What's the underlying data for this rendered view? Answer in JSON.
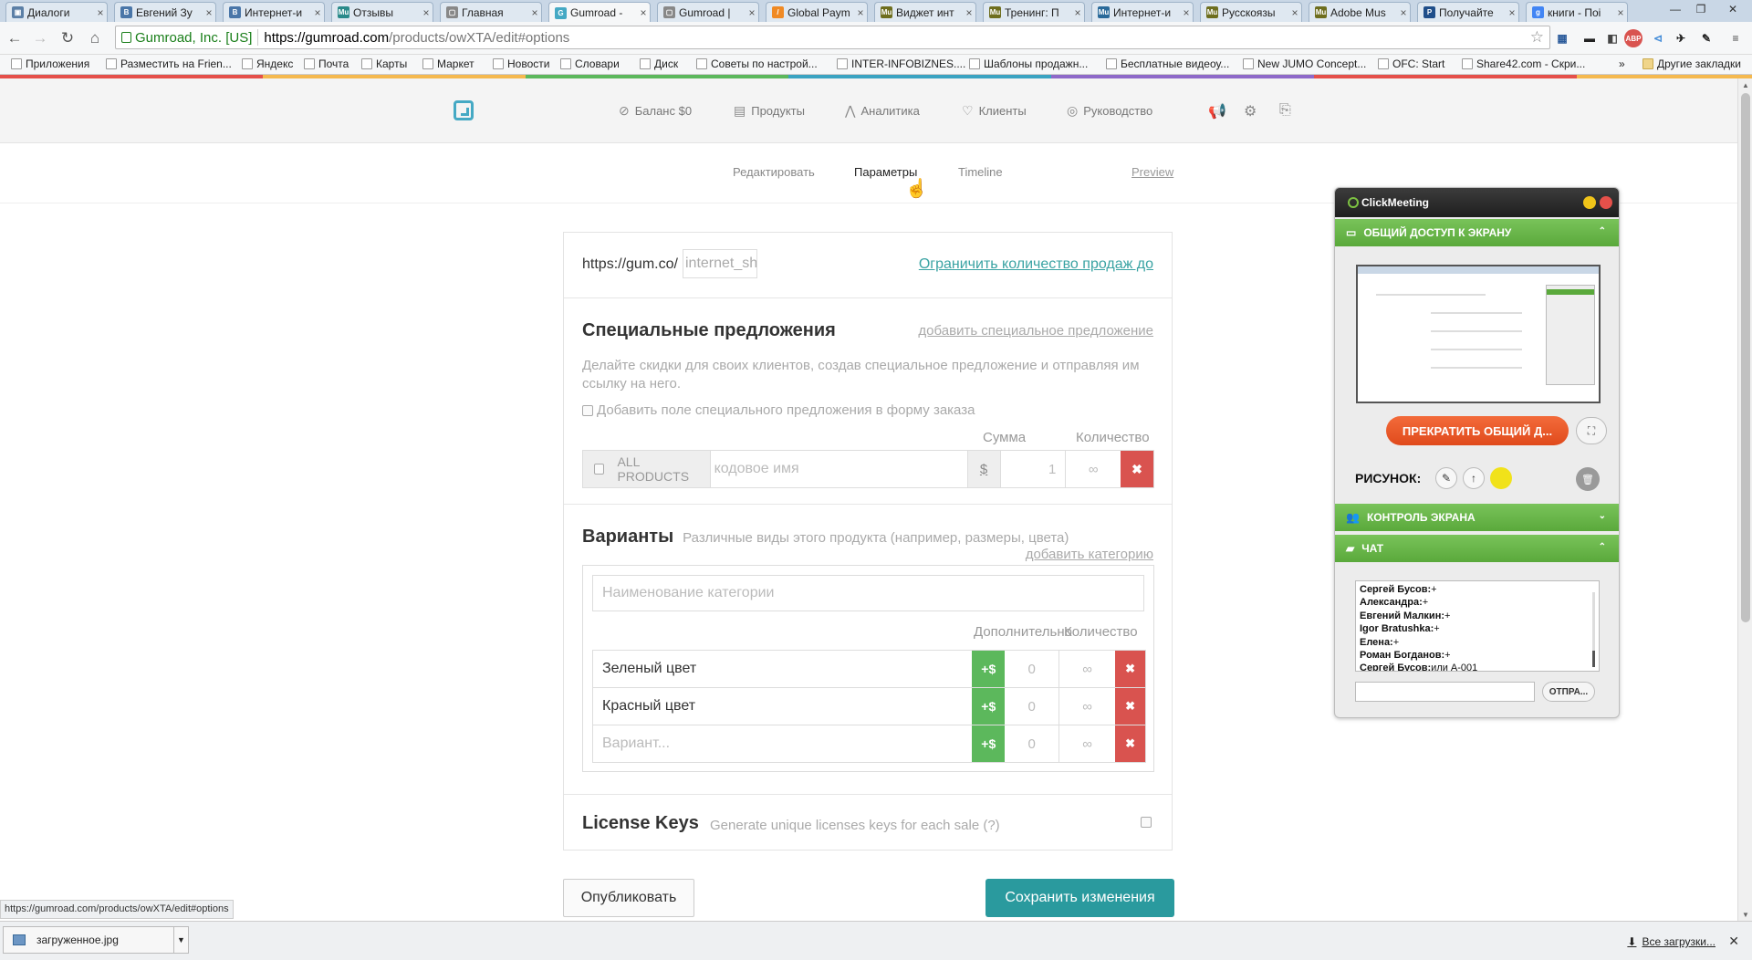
{
  "browser": {
    "tabs": [
      {
        "label": "Диалоги",
        "color": "#5b7fa6",
        "glyph": "▣"
      },
      {
        "label": "Евгений Зу",
        "color": "#4a76a8",
        "glyph": "B"
      },
      {
        "label": "Интернет-и",
        "color": "#4a76a8",
        "glyph": "B"
      },
      {
        "label": "Отзывы",
        "color": "#2a8a8a",
        "glyph": "Mu"
      },
      {
        "label": "Главная",
        "color": "#888888",
        "glyph": "▢"
      },
      {
        "label": "Gumroad -",
        "color": "#45a9c4",
        "glyph": "G"
      },
      {
        "label": "Gumroad |",
        "color": "#888888",
        "glyph": "▢"
      },
      {
        "label": "Global Paym",
        "color": "#f08a24",
        "glyph": "/"
      },
      {
        "label": "Виджет инт",
        "color": "#6e6e1e",
        "glyph": "Mu"
      },
      {
        "label": "Тренинг: П",
        "color": "#6e6e1e",
        "glyph": "Mu"
      },
      {
        "label": "Интернет-и",
        "color": "#2a6a9a",
        "glyph": "Mu"
      },
      {
        "label": "Русскоязы",
        "color": "#6e6e1e",
        "glyph": "Mu"
      },
      {
        "label": "Adobe Mus",
        "color": "#6e6e1e",
        "glyph": "Mu"
      },
      {
        "label": "Получайте",
        "color": "#1f4e8a",
        "glyph": "P"
      },
      {
        "label": "книги - Поі",
        "color": "#4285f4",
        "glyph": "g"
      }
    ],
    "secure_label": "Gumroad, Inc. [US]",
    "url_host": "https://gumroad.com",
    "url_path": "/products/owXTA/edit#options",
    "bookmarks": [
      "Приложения",
      "Разместить на Frien...",
      "Яндекс",
      "Почта",
      "Карты",
      "Маркет",
      "Новости",
      "Словари",
      "Диск",
      "Советы по настрой...",
      "INTER-INFOBIZNES....",
      "Шаблоны продажн...",
      "Бесплатные видеоу...",
      "New JUMO Concept...",
      "OFC: Start",
      "Share42.com - Скри..."
    ],
    "other_bookmarks": "Другие закладки",
    "more_bookmarks": "»"
  },
  "gumroad": {
    "nav": {
      "balance": "Баланс $0",
      "products": "Продукты",
      "analytics": "Аналитика",
      "customers": "Клиенты",
      "guide": "Руководство"
    },
    "subnav": {
      "edit": "Редактировать",
      "params": "Параметры",
      "timeline": "Timeline",
      "preview": "Preview"
    },
    "url_section": {
      "prefix": "https://gum.co/",
      "slug": "internet_sh",
      "limit_link": "Ограничить количество продаж до"
    },
    "offers": {
      "title": "Специальные предложения",
      "add_link": "добавить специальное предложение",
      "desc": "Делайте скидки для своих клиентов, создав специальное предложение и отправляя им ссылку на него.",
      "checkbox_label": "Добавить поле специального предложения в форму заказа",
      "col_amount": "Сумма",
      "col_qty": "Количество",
      "all_products": "ALL PRODUCTS",
      "code_placeholder": "кодовое имя",
      "currency": "$",
      "amount_placeholder": "1",
      "qty_placeholder": "∞",
      "remove": "✖"
    },
    "variants": {
      "title": "Варианты",
      "subtitle": "Различные виды этого продукта (например, размеры, цвета)",
      "add_category": "добавить категорию",
      "category_placeholder": "Наименование категории",
      "col_extra": "Дополнительно",
      "col_qty": "Количество",
      "plus": "+$",
      "rows": [
        {
          "name": "Зеленый цвет",
          "price": "0",
          "qty": "∞"
        },
        {
          "name": "Красный цвет",
          "price": "0",
          "qty": "∞"
        }
      ],
      "new_placeholder": "Вариант...",
      "new_price": "0",
      "new_qty": "∞",
      "remove": "✖"
    },
    "license": {
      "title": "License Keys",
      "subtitle": "Generate unique licenses keys for each sale (?)"
    },
    "publish": "Опубликовать",
    "save": "Сохранить изменения"
  },
  "status_url": "https://gumroad.com/products/owXTA/edit#options",
  "downloads": {
    "file": "загруженное.jpg",
    "all": "Все загрузки..."
  },
  "clickmeeting": {
    "logo": "ClickMeeting",
    "screen_share": "ОБЩИЙ ДОСТУП К ЭКРАНУ",
    "stop_share": "ПРЕКРАТИТЬ ОБЩИЙ Д...",
    "drawing": "РИСУНОК:",
    "screen_control": "КОНТРОЛЬ ЭКРАНА",
    "chat": "ЧАТ",
    "chat_log": [
      {
        "name": "Сергей Бусов:",
        "msg": "+"
      },
      {
        "name": "Александра:",
        "msg": "+"
      },
      {
        "name": "Евгений Малкин:",
        "msg": "+"
      },
      {
        "name": "Igor Bratushka:",
        "msg": "+"
      },
      {
        "name": "Елена:",
        "msg": "+"
      },
      {
        "name": "Роман Богданов:",
        "msg": "+"
      },
      {
        "name": "Сергей Бусов:",
        "msg": "или А-001"
      }
    ],
    "send": "ОТПРА..."
  }
}
